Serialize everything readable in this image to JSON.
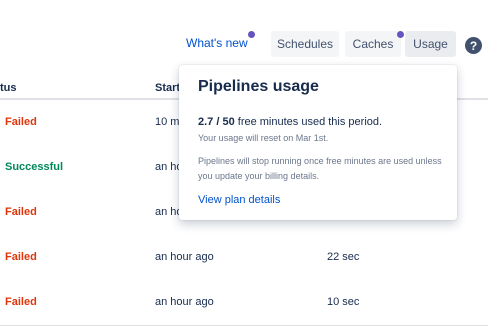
{
  "toolbar": {
    "whats_new": "What's new",
    "schedules": "Schedules",
    "caches": "Caches",
    "usage": "Usage",
    "help": "?"
  },
  "table": {
    "headers": {
      "status": "tus",
      "started": "Start"
    },
    "rows": [
      {
        "status": "Failed",
        "started": "10 m",
        "duration": ""
      },
      {
        "status": "Successful",
        "started": "an ho",
        "duration": ""
      },
      {
        "status": "Failed",
        "started": "an ho",
        "duration": ""
      },
      {
        "status": "Failed",
        "started": "an hour ago",
        "duration": "22 sec"
      },
      {
        "status": "Failed",
        "started": "an hour ago",
        "duration": "10 sec"
      }
    ]
  },
  "usage_popover": {
    "title": "Pipelines usage",
    "minutes_used": "2.7 / 50",
    "minutes_suffix": " free minutes used this period.",
    "reset_note": "Your usage will reset on Mar 1st.",
    "billing_note": "Pipelines will stop running once free minutes are used unless you update your billing details.",
    "link": "View plan details"
  },
  "colors": {
    "failed": "#de350b",
    "successful": "#00875a",
    "link": "#0052cc",
    "notification_dot": "#6554c0"
  }
}
